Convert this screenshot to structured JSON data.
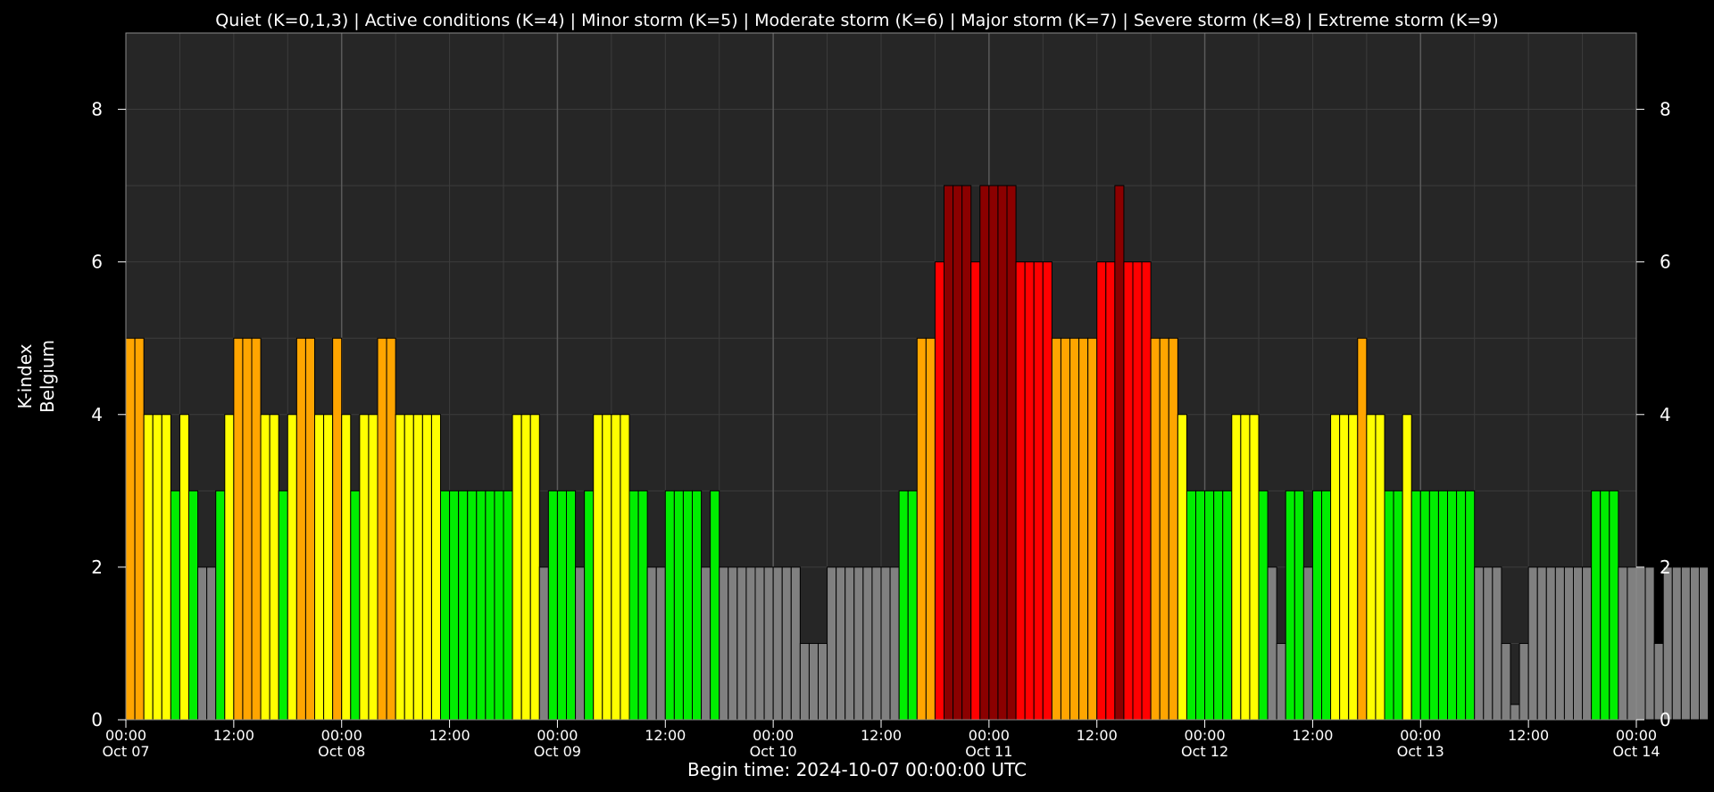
{
  "chart_data": {
    "type": "bar",
    "title": "Quiet (K=0,1,3) | Active conditions (K=4) | Minor storm (K=5) | Moderate storm (K=6) | Major storm (K=7) | Severe storm (K=8) | Extreme storm (K=9)",
    "ylabel": [
      "K-index",
      "Belgium"
    ],
    "xlabel": "Begin time: 2024-10-07 00:00:00 UTC",
    "ylim": [
      0,
      9
    ],
    "xlim_hours": [
      0,
      168
    ],
    "bin_hours": 1,
    "grid": true,
    "y_ticks": [
      0,
      2,
      4,
      6,
      8
    ],
    "x_ticks": [
      {
        "hour": 0,
        "time": "00:00",
        "date": "Oct 07"
      },
      {
        "hour": 12,
        "time": "12:00",
        "date": ""
      },
      {
        "hour": 24,
        "time": "00:00",
        "date": "Oct 08"
      },
      {
        "hour": 36,
        "time": "12:00",
        "date": ""
      },
      {
        "hour": 48,
        "time": "00:00",
        "date": "Oct 09"
      },
      {
        "hour": 60,
        "time": "12:00",
        "date": ""
      },
      {
        "hour": 72,
        "time": "00:00",
        "date": "Oct 10"
      },
      {
        "hour": 84,
        "time": "12:00",
        "date": ""
      },
      {
        "hour": 96,
        "time": "00:00",
        "date": "Oct 11"
      },
      {
        "hour": 108,
        "time": "12:00",
        "date": ""
      },
      {
        "hour": 120,
        "time": "00:00",
        "date": "Oct 12"
      },
      {
        "hour": 132,
        "time": "12:00",
        "date": ""
      },
      {
        "hour": 144,
        "time": "00:00",
        "date": "Oct 13"
      },
      {
        "hour": 156,
        "time": "12:00",
        "date": ""
      },
      {
        "hour": 168,
        "time": "00:00",
        "date": "Oct 14"
      }
    ],
    "colors": {
      "quiet": "#808080",
      "k3": "#00ee00",
      "active": "#ffff00",
      "minor": "#ffa500",
      "moderate": "#ff0000",
      "major": "#8b0000",
      "background": "#000000",
      "plot_background": "#262626",
      "grid": "#3c3c3c",
      "bar_edge": "#000000"
    },
    "values": [
      5,
      5,
      4,
      4,
      4,
      3,
      4,
      3,
      2,
      2,
      3,
      4,
      5,
      5,
      5,
      4,
      4,
      3,
      4,
      5,
      5,
      4,
      4,
      5,
      4,
      3,
      4,
      4,
      5,
      5,
      4,
      4,
      4,
      4,
      4,
      3,
      3,
      3,
      3,
      3,
      3,
      3,
      3,
      4,
      4,
      4,
      2,
      3,
      3,
      3,
      2,
      3,
      4,
      4,
      4,
      4,
      3,
      3,
      2,
      2,
      3,
      3,
      3,
      3,
      2,
      3,
      2,
      2,
      2,
      2,
      2,
      2,
      2,
      2,
      2,
      1,
      1,
      1,
      2,
      2,
      2,
      2,
      2,
      2,
      2,
      2,
      3,
      3,
      5,
      5,
      6,
      7,
      7,
      7,
      6,
      7,
      7,
      7,
      7,
      6,
      6,
      6,
      6,
      5,
      5,
      5,
      5,
      5,
      6,
      6,
      7,
      6,
      6,
      6,
      5,
      5,
      5,
      4,
      3,
      3,
      3,
      3,
      3,
      4,
      4,
      4,
      3,
      2,
      1,
      3,
      3,
      2,
      3,
      3,
      4,
      4,
      4,
      5,
      4,
      4,
      3,
      3,
      4,
      3,
      3,
      3,
      3,
      3,
      3,
      3,
      2,
      2,
      2,
      1,
      0.2,
      1,
      2,
      2,
      2,
      2,
      2,
      2,
      2,
      3,
      3,
      3,
      2,
      2,
      2,
      2,
      1,
      2,
      2,
      2,
      2,
      2
    ]
  }
}
